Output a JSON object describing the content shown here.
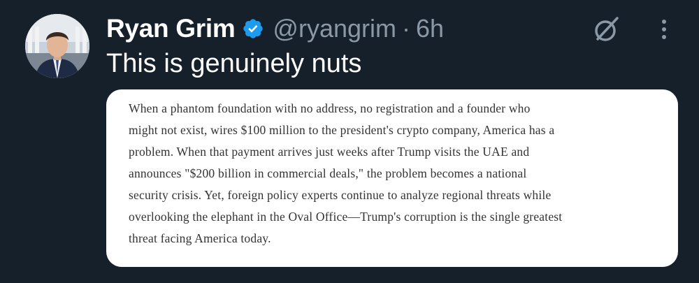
{
  "author": {
    "display_name": "Ryan Grim",
    "handle": "@ryangrim",
    "separator": "·",
    "time_ago": "6h"
  },
  "tweet": {
    "text": "This is genuinely nuts"
  },
  "media": {
    "lines": [
      "When a phantom foundation with no address, no registration and a founder who",
      "might not exist, wires $100 million to the president's crypto company, America has a",
      "problem. When that payment arrives just weeks after Trump visits the UAE and",
      "announces \"$200 billion in commercial deals,\" the problem becomes a national",
      "security crisis. Yet, foreign policy experts continue to analyze regional threats while",
      "overlooking the elephant in the Oval Office—Trump's corruption is the single greatest",
      "threat facing America today."
    ]
  },
  "icons": {
    "verified": "verified-badge-icon",
    "grok": "grok-icon",
    "more": "more-options-icon"
  },
  "colors": {
    "background": "#15202b",
    "primary_text": "#ffffff",
    "secondary_text": "#8b98a5",
    "verified_blue": "#1d9bf0"
  }
}
